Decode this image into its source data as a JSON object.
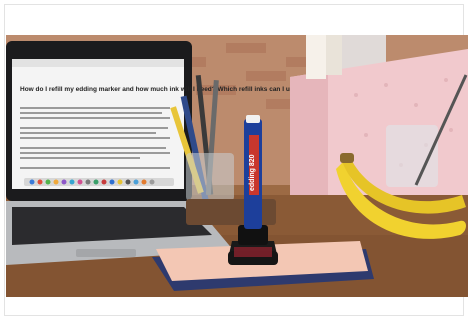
{
  "photo": {
    "alt_subject": "edding refill ink bottle with marker on desk",
    "laptop_screen": {
      "heading": "How do I refill my edding marker and how much ink will I need? Which refill inks can I use?",
      "brand_label": "edding"
    },
    "marker_label": "edding 820",
    "colors": {
      "brick": "#b0704f",
      "desk": "#8a5a36",
      "card_pink": "#f3c7b4",
      "card_navy": "#2e3a6e",
      "marker_blue": "#1d3f9b",
      "marker_red": "#c8372d",
      "banana": "#f1d22f",
      "file_box": "#f1c9cd"
    }
  }
}
